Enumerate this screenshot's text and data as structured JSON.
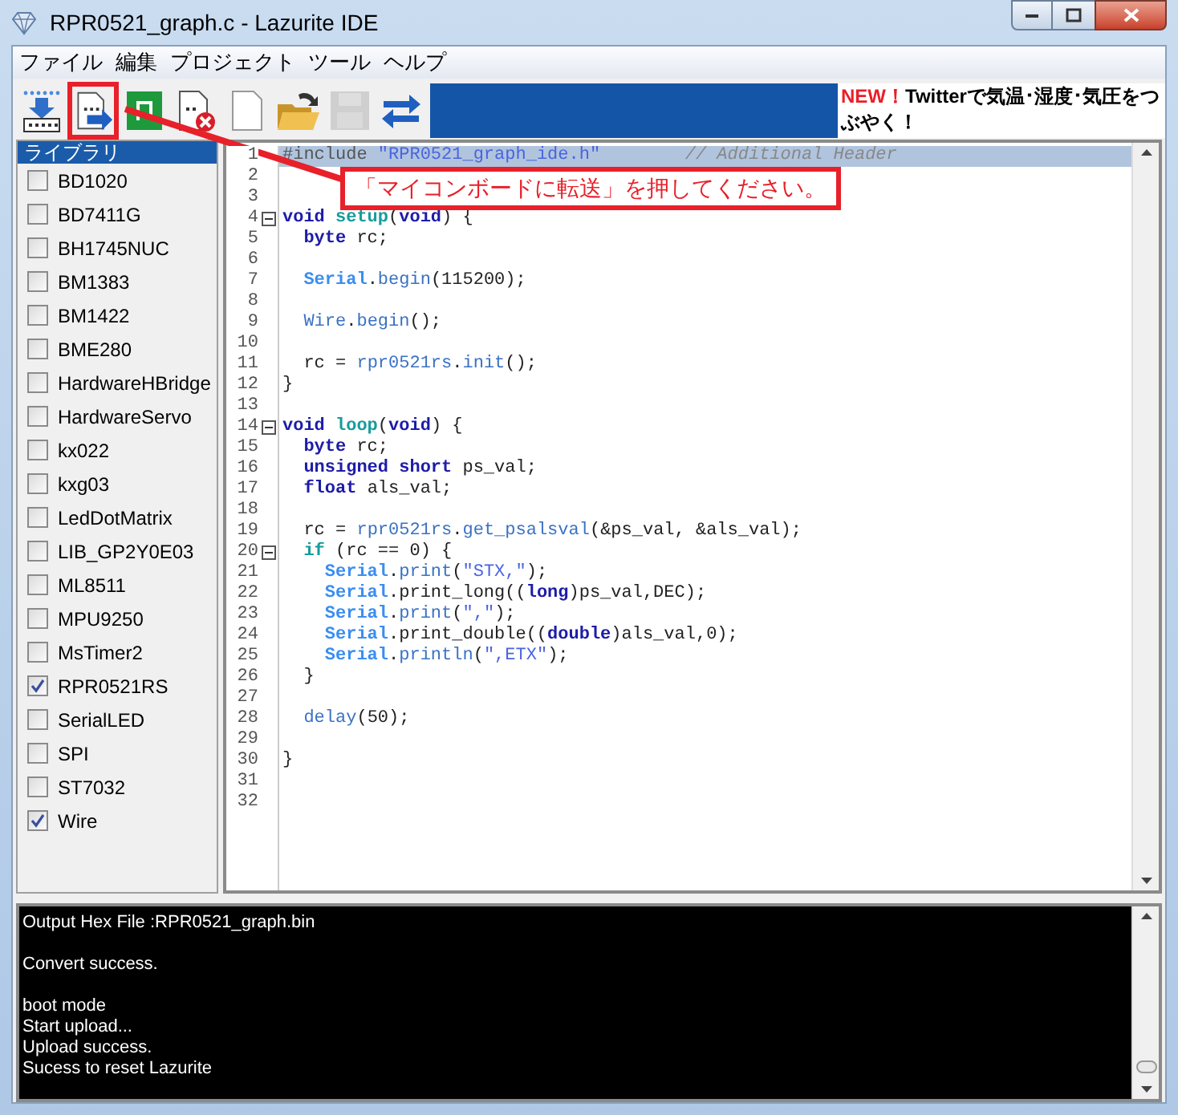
{
  "window": {
    "title": "RPR0521_graph.c - Lazurite IDE"
  },
  "menu": [
    "ファイル",
    "編集",
    "プロジェクト",
    "ツール",
    "ヘルプ"
  ],
  "toolbar": [
    {
      "kind": "download",
      "highlighted": false,
      "disabled": false
    },
    {
      "kind": "transfer",
      "highlighted": true,
      "disabled": false
    },
    {
      "kind": "green",
      "highlighted": false,
      "disabled": false
    },
    {
      "kind": "delete",
      "highlighted": false,
      "disabled": false
    },
    {
      "kind": "new",
      "highlighted": false,
      "disabled": false
    },
    {
      "kind": "open",
      "highlighted": false,
      "disabled": false
    },
    {
      "kind": "save",
      "highlighted": false,
      "disabled": true
    },
    {
      "kind": "swap",
      "highlighted": false,
      "disabled": false
    }
  ],
  "news": {
    "badge": "NEW！",
    "text": "Twitterで気温･湿度･気圧をつぶやく！"
  },
  "callout": {
    "text": "「マイコンボードに転送」を押してください。"
  },
  "library": {
    "title": "ライブラリ",
    "items": [
      {
        "label": "BD1020",
        "checked": false
      },
      {
        "label": "BD7411G",
        "checked": false
      },
      {
        "label": "BH1745NUC",
        "checked": false
      },
      {
        "label": "BM1383",
        "checked": false
      },
      {
        "label": "BM1422",
        "checked": false
      },
      {
        "label": "BME280",
        "checked": false
      },
      {
        "label": "HardwareHBridge",
        "checked": false
      },
      {
        "label": "HardwareServo",
        "checked": false
      },
      {
        "label": "kx022",
        "checked": false
      },
      {
        "label": "kxg03",
        "checked": false
      },
      {
        "label": "LedDotMatrix",
        "checked": false
      },
      {
        "label": "LIB_GP2Y0E03",
        "checked": false
      },
      {
        "label": "ML8511",
        "checked": false
      },
      {
        "label": "MPU9250",
        "checked": false
      },
      {
        "label": "MsTimer2",
        "checked": false
      },
      {
        "label": "RPR0521RS",
        "checked": true
      },
      {
        "label": "SerialLED",
        "checked": false
      },
      {
        "label": "SPI",
        "checked": false
      },
      {
        "label": "ST7032",
        "checked": false
      },
      {
        "label": "Wire",
        "checked": true
      }
    ]
  },
  "code": {
    "lines": [
      {
        "number": "1",
        "fold": false,
        "highlighted": true,
        "segments": [
          {
            "kind": "preproc",
            "text": "#include "
          },
          {
            "kind": "string",
            "text": "\"RPR0521_graph_ide.h\""
          },
          {
            "kind": "comment",
            "text": "        // Additional Header"
          }
        ]
      },
      {
        "number": "2",
        "fold": false,
        "highlighted": false
      },
      {
        "number": "3",
        "fold": false,
        "highlighted": false
      },
      {
        "number": "4",
        "fold": true,
        "highlighted": false,
        "segments": [
          {
            "kind": "keyword",
            "text": "void"
          },
          {
            "kind": "control",
            "text": " setup"
          },
          {
            "kind": "plain",
            "text": "("
          },
          {
            "kind": "keyword",
            "text": "void"
          },
          {
            "kind": "plain",
            "text": ") {"
          }
        ]
      },
      {
        "number": "5",
        "fold": false,
        "highlighted": false,
        "segments": [
          {
            "kind": "keyword",
            "text": "  byte"
          },
          {
            "kind": "plain",
            "text": " rc;"
          }
        ]
      },
      {
        "number": "6",
        "fold": false,
        "highlighted": false
      },
      {
        "number": "7",
        "fold": false,
        "highlighted": false,
        "segments": [
          {
            "kind": "class",
            "text": "  Serial"
          },
          {
            "kind": "plain",
            "text": "."
          },
          {
            "kind": "function",
            "text": "begin"
          },
          {
            "kind": "plain",
            "text": "(115200);"
          }
        ]
      },
      {
        "number": "8",
        "fold": false,
        "highlighted": false
      },
      {
        "number": "9",
        "fold": false,
        "highlighted": false,
        "segments": [
          {
            "kind": "function",
            "text": "  Wire"
          },
          {
            "kind": "plain",
            "text": "."
          },
          {
            "kind": "function",
            "text": "begin"
          },
          {
            "kind": "plain",
            "text": "();"
          }
        ]
      },
      {
        "number": "10",
        "fold": false,
        "highlighted": false
      },
      {
        "number": "11",
        "fold": false,
        "highlighted": false,
        "segments": [
          {
            "kind": "plain",
            "text": "  rc = "
          },
          {
            "kind": "function",
            "text": "rpr0521rs"
          },
          {
            "kind": "plain",
            "text": "."
          },
          {
            "kind": "function",
            "text": "init"
          },
          {
            "kind": "plain",
            "text": "();"
          }
        ]
      },
      {
        "number": "12",
        "fold": false,
        "highlighted": false,
        "segments": [
          {
            "kind": "plain",
            "text": "}"
          }
        ]
      },
      {
        "number": "13",
        "fold": false,
        "highlighted": false
      },
      {
        "number": "14",
        "fold": true,
        "highlighted": false,
        "segments": [
          {
            "kind": "keyword",
            "text": "void"
          },
          {
            "kind": "control",
            "text": " loop"
          },
          {
            "kind": "plain",
            "text": "("
          },
          {
            "kind": "keyword",
            "text": "void"
          },
          {
            "kind": "plain",
            "text": ") {"
          }
        ]
      },
      {
        "number": "15",
        "fold": false,
        "highlighted": false,
        "segments": [
          {
            "kind": "keyword",
            "text": "  byte"
          },
          {
            "kind": "plain",
            "text": " rc;"
          }
        ]
      },
      {
        "number": "16",
        "fold": false,
        "highlighted": false,
        "segments": [
          {
            "kind": "keyword",
            "text": "  unsigned short"
          },
          {
            "kind": "plain",
            "text": " ps_val;"
          }
        ]
      },
      {
        "number": "17",
        "fold": false,
        "highlighted": false,
        "segments": [
          {
            "kind": "keyword",
            "text": "  float"
          },
          {
            "kind": "plain",
            "text": " als_val;"
          }
        ]
      },
      {
        "number": "18",
        "fold": false,
        "highlighted": false
      },
      {
        "number": "19",
        "fold": false,
        "highlighted": false,
        "segments": [
          {
            "kind": "plain",
            "text": "  rc = "
          },
          {
            "kind": "function",
            "text": "rpr0521rs"
          },
          {
            "kind": "plain",
            "text": "."
          },
          {
            "kind": "function",
            "text": "get_psalsval"
          },
          {
            "kind": "plain",
            "text": "(&ps_val, &als_val);"
          }
        ]
      },
      {
        "number": "20",
        "fold": true,
        "highlighted": false,
        "segments": [
          {
            "kind": "control",
            "text": "  if"
          },
          {
            "kind": "plain",
            "text": " (rc == 0) {"
          }
        ]
      },
      {
        "number": "21",
        "fold": false,
        "highlighted": false,
        "segments": [
          {
            "kind": "class",
            "text": "    Serial"
          },
          {
            "kind": "plain",
            "text": "."
          },
          {
            "kind": "function",
            "text": "print"
          },
          {
            "kind": "plain",
            "text": "("
          },
          {
            "kind": "string",
            "text": "\"STX,\""
          },
          {
            "kind": "plain",
            "text": ");"
          }
        ]
      },
      {
        "number": "22",
        "fold": false,
        "highlighted": false,
        "segments": [
          {
            "kind": "class",
            "text": "    Serial"
          },
          {
            "kind": "plain",
            "text": ".print_long(("
          },
          {
            "kind": "keyword",
            "text": "long"
          },
          {
            "kind": "plain",
            "text": ")ps_val,DEC);"
          }
        ]
      },
      {
        "number": "23",
        "fold": false,
        "highlighted": false,
        "segments": [
          {
            "kind": "class",
            "text": "    Serial"
          },
          {
            "kind": "plain",
            "text": "."
          },
          {
            "kind": "function",
            "text": "print"
          },
          {
            "kind": "plain",
            "text": "("
          },
          {
            "kind": "string",
            "text": "\",\""
          },
          {
            "kind": "plain",
            "text": ");"
          }
        ]
      },
      {
        "number": "24",
        "fold": false,
        "highlighted": false,
        "segments": [
          {
            "kind": "class",
            "text": "    Serial"
          },
          {
            "kind": "plain",
            "text": ".print_double(("
          },
          {
            "kind": "keyword",
            "text": "double"
          },
          {
            "kind": "plain",
            "text": ")als_val,0);"
          }
        ]
      },
      {
        "number": "25",
        "fold": false,
        "highlighted": false,
        "segments": [
          {
            "kind": "class",
            "text": "    Serial"
          },
          {
            "kind": "plain",
            "text": "."
          },
          {
            "kind": "function",
            "text": "println"
          },
          {
            "kind": "plain",
            "text": "("
          },
          {
            "kind": "string",
            "text": "\",ETX\""
          },
          {
            "kind": "plain",
            "text": ");"
          }
        ]
      },
      {
        "number": "26",
        "fold": false,
        "highlighted": false,
        "segments": [
          {
            "kind": "plain",
            "text": "  }"
          }
        ]
      },
      {
        "number": "27",
        "fold": false,
        "highlighted": false
      },
      {
        "number": "28",
        "fold": false,
        "highlighted": false,
        "segments": [
          {
            "kind": "function",
            "text": "  delay"
          },
          {
            "kind": "plain",
            "text": "(50);"
          }
        ]
      },
      {
        "number": "29",
        "fold": false,
        "highlighted": false
      },
      {
        "number": "30",
        "fold": false,
        "highlighted": false,
        "segments": [
          {
            "kind": "plain",
            "text": "}"
          }
        ]
      },
      {
        "number": "31",
        "fold": false,
        "highlighted": false
      },
      {
        "number": "32",
        "fold": false,
        "highlighted": false
      }
    ]
  },
  "console": {
    "blocks": [
      [
        "Output Hex File :RPR0521_graph.bin"
      ],
      [
        "Convert success."
      ],
      [
        "boot mode",
        "Start upload...",
        "Upload success.",
        "Sucess to reset Lazurite"
      ]
    ]
  }
}
